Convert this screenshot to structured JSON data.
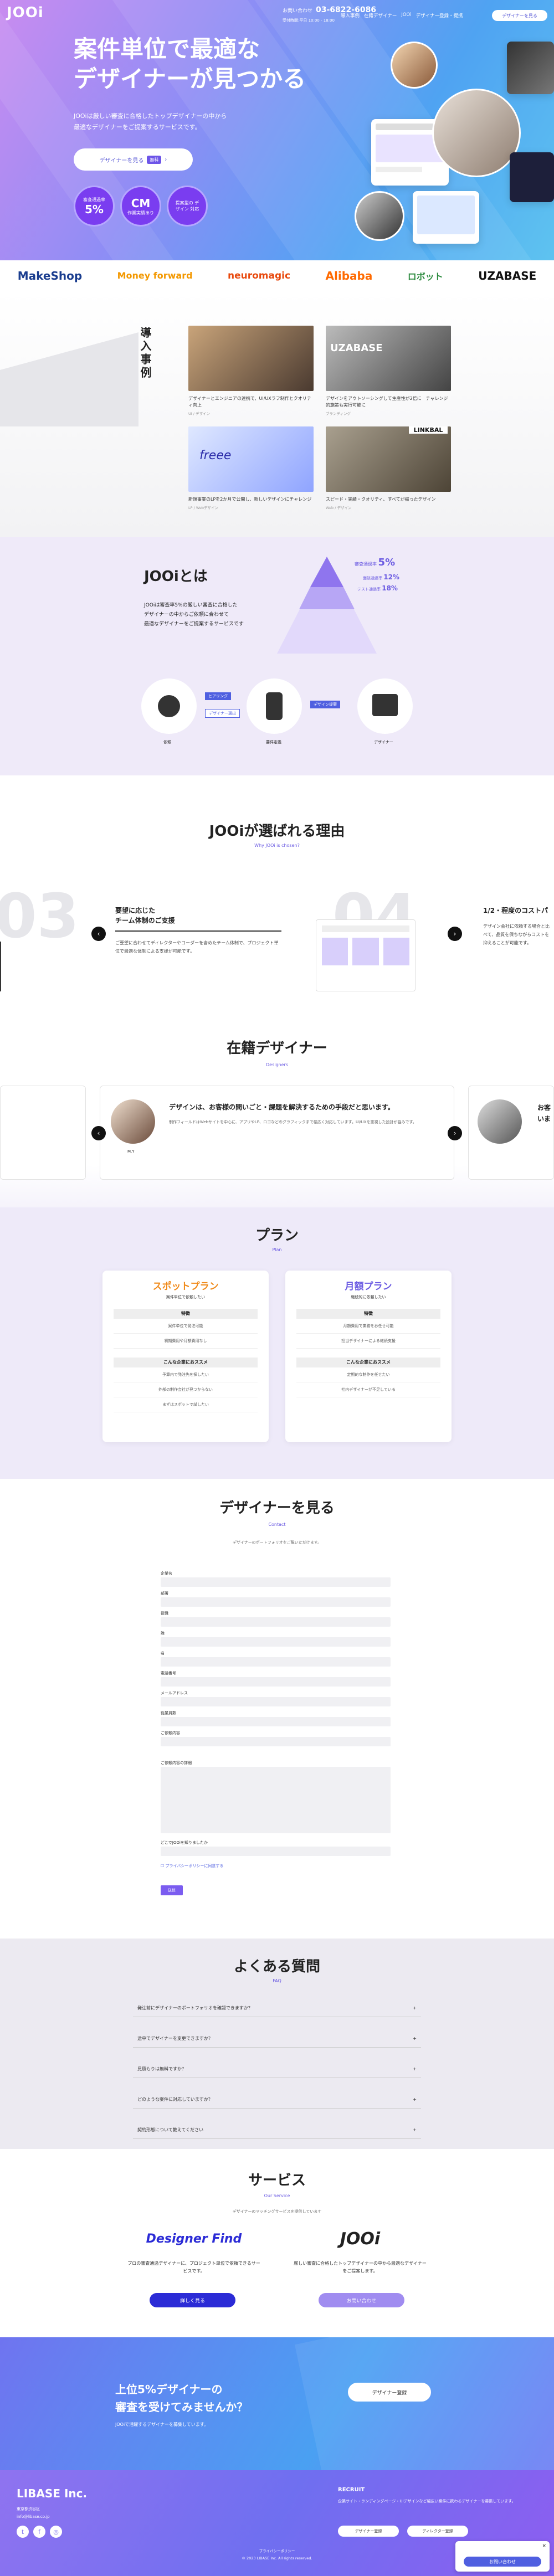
{
  "header": {
    "logo": "JOOi",
    "tel_label": "お問い合わせ",
    "tel": "03-6822-6086",
    "tel_hours": "受付時間:平日 10:00 - 18:00",
    "nav": [
      "導入事例",
      "JOOiとは",
      "選ばれる理由",
      "在籍デザイナー",
      "プラン",
      "FAQ"
    ],
    "links": [
      "導入事例",
      "在籍デザイナー",
      "JOOi",
      "よくある質問",
      "サービス",
      "会社概要",
      "デザイナー登録・提携",
      "個人情報保護"
    ],
    "cta": "デザイナーを見る"
  },
  "hero": {
    "title_l1": "案件単位で最適な",
    "title_l2": "デザイナーが見つかる",
    "sub_l1": "JOOiは厳しい審査に合格したトップデザイナーの中から",
    "sub_l2": "最適なデザイナーをご提案するサービスです。",
    "cta": "デザイナーを見る",
    "cta_tag": "無料",
    "badges": [
      {
        "top": "審査通過率",
        "big": "5%",
        "bot": ""
      },
      {
        "top": "CM",
        "big": "",
        "bot": "作業実績あり"
      },
      {
        "top": "",
        "big": "",
        "bot": "提案型の デザイン 対応"
      }
    ]
  },
  "logos": [
    "MakeShop",
    "Money forward",
    "neuromagic",
    "Alibaba",
    "ロボット",
    "UZABASE"
  ],
  "cases": {
    "title": "導入事例",
    "cards": [
      {
        "text": "デザイナーとエンジニアの連携で、UI/UXラフ制作とクオリティ向上",
        "meta": "UI / デザイン"
      },
      {
        "text": "デザインをアウトソーシングして生産性が2倍に　チャレンジ的施策も実行可能に",
        "meta": "ブランディング"
      },
      {
        "text": "新規事業のLPを2か月で公開し、新しいデザインにチャレンジ",
        "meta": "LP / Webデザイン"
      },
      {
        "text": "スピード・実績・クオリティ、すべてが揃ったデザイン",
        "meta": "Web / デザイン"
      }
    ]
  },
  "about": {
    "title": "JOOiとは",
    "text_l1": "JOOiは審査率5%の厳しい審査に合格した",
    "text_l2": "デザイナーの中からご依頼に合わせて",
    "text_l3": "最適なデザイナーをご提案するサービスです",
    "pyr_main": "審査通過率",
    "pyr_pct": "5%",
    "pyr_2": "面談通過率",
    "pyr_2p": "12%",
    "pyr_3": "テスト通過率",
    "pyr_3p": "18%",
    "flow": [
      "依頼",
      "要件定義",
      "デザイナー"
    ],
    "flow_tags": [
      "ヒアリング",
      "デザイナー選出",
      "デザイン提案"
    ]
  },
  "why": {
    "title": "JOOiが選ばれる理由",
    "sub": "Why JOOi is chosen?",
    "num_a": "03",
    "num_b": "04",
    "head": "要望に応じた",
    "head2": "チーム体制のご支援",
    "body": "ご要望に合わせてディレクターやコーダーを含めたチーム体制で、プロジェクト単位で最適な体制による支援が可能です。",
    "right_head": "1/2・程度のコストパ",
    "right_body": "デザイン会社に依頼する場合と比べて、品質を保ちながらコストを抑えることが可能です。"
  },
  "designers": {
    "title": "在籍デザイナー",
    "sub": "Designers",
    "quote": "デザインは、お客様の問いごと・課題を解決するための手段だと思います。",
    "body": "制作フィールドはWebサイトを中心に、アプリやLP、ロゴなどのグラフィックまで幅広く対応しています。UI/UXを重視した設計が強みです。",
    "name": "M.Y",
    "right_quote": "お客",
    "right_q2": "いま"
  },
  "plans": {
    "title": "プラン",
    "sub": "Plan",
    "items": [
      {
        "name": "スポットプラン",
        "desc": "案件単位で依頼したい",
        "feat": "特徴",
        "f1": "案件単位で発注可能",
        "f2": "初期費用や月額費用なし",
        "for": "こんな企業におススメ",
        "r1": "予算内で発注先を探したい",
        "r2": "外部の制作会社が見つからない",
        "r3": "まずはスポットで試したい"
      },
      {
        "name": "月額プラン",
        "desc": "継続的に依頼したい",
        "feat": "特徴",
        "f1": "月額費用で業務をお任せ可能",
        "f2": "担当デザイナーによる継続支援",
        "for": "こんな企業におススメ",
        "r1": "定期的な制作を任せたい",
        "r2": "社内デザイナーが不足している",
        "r3": ""
      }
    ]
  },
  "contact": {
    "title": "デザイナーを見る",
    "sub": "Contact",
    "desc": "デザイナーのポートフォリオをご覧いただけます。",
    "fields": [
      "企業名",
      "部署",
      "役職",
      "姓",
      "名",
      "電話番号",
      "メールアドレス",
      "従業員数",
      "ご依頼内容",
      "ご依頼内容の詳細",
      "どこでJOOiを知りましたか"
    ],
    "privacy": "プライバシーポリシーに同意する",
    "submit": "送信"
  },
  "faq": {
    "title": "よくある質問",
    "sub": "FAQ",
    "items": [
      "発注前にデザイナーのポートフォリオを確認できますか？",
      "途中でデザイナーを変更できますか？",
      "見積もりは無料ですか？",
      "どのような案件に対応していますか？",
      "契約形態について教えてください"
    ]
  },
  "service": {
    "title": "サービス",
    "sub": "Our Service",
    "desc": "デザイナーのマッチングサービスを提供しています",
    "s1_name": "Designer Find",
    "s1_text": "プロの審査通過デザイナーに、プロジェクト単位で依頼できるサービスです。",
    "s1_btn": "詳しく見る",
    "s2_name": "JOOi",
    "s2_text": "厳しい審査に合格したトップデザイナーの中から最適なデザイナーをご提案します。",
    "s2_btn": "お問い合わせ"
  },
  "cta_band": {
    "title_l1": "上位5%デザイナーの",
    "title_l2": "審査を受けてみませんか？",
    "text": "JOOiで活躍するデザイナーを募集しています。",
    "btn": "デザイナー登録"
  },
  "footer": {
    "company": "LIBASE Inc.",
    "addr": "東京都渋谷区",
    "email": "info@libase.co.jp",
    "recruit": "RECRUIT",
    "recruit_text": "企業サイト・ランディングページ・UIデザインなど幅広い案件に携わるデザイナーを募集しています。",
    "btn1": "デザイナー登録",
    "btn2": "ディレクター登録",
    "links": "プライバシーポリシー",
    "copy": "© 2023 LIBASE Inc. All rights reserved.",
    "float": "お問い合わせ"
  }
}
